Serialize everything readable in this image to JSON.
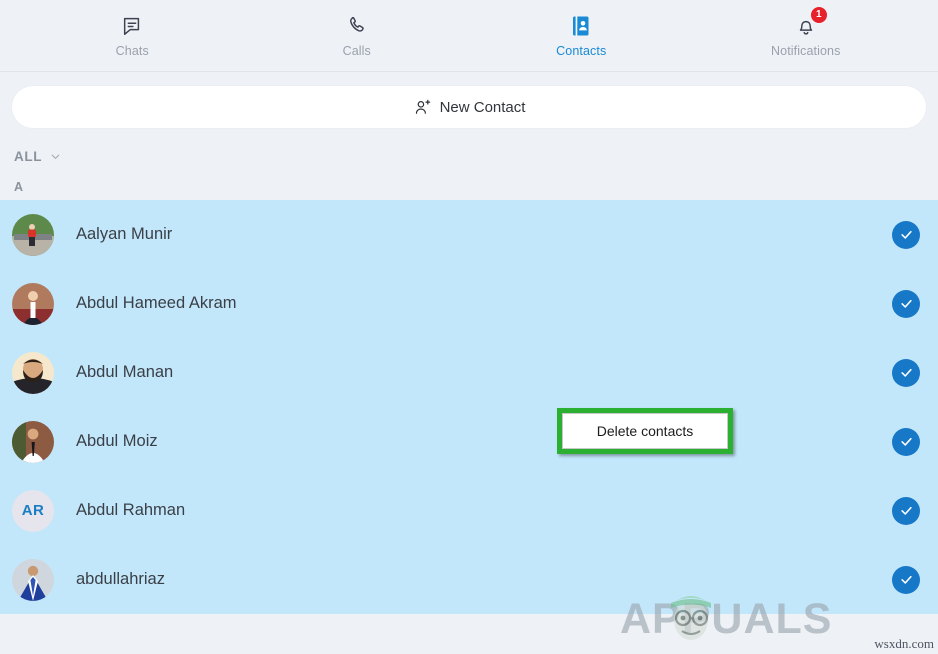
{
  "app": {
    "accent_color": "#1878c8",
    "selection_color": "#c3e7fa",
    "background_color": "#eef1f6",
    "highlight_outline_color": "#2cb032",
    "badge_color": "#e8202a"
  },
  "tabs": [
    {
      "label": "Chats",
      "icon": "chat-bubble-icon",
      "active": false,
      "badge": null
    },
    {
      "label": "Calls",
      "icon": "phone-handset-icon",
      "active": false,
      "badge": null
    },
    {
      "label": "Contacts",
      "icon": "contact-book-icon",
      "active": true,
      "badge": null
    },
    {
      "label": "Notifications",
      "icon": "bell-icon",
      "active": false,
      "badge": "1"
    }
  ],
  "new_contact": {
    "label": "New Contact",
    "icon": "person-plus-icon"
  },
  "filter": {
    "label": "ALL",
    "icon": "chevron-down-icon"
  },
  "list": {
    "section_letter": "A",
    "contacts": [
      {
        "name": "Aalyan Munir",
        "avatar_type": "photo",
        "initials": "",
        "selected": true
      },
      {
        "name": "Abdul Hameed Akram",
        "avatar_type": "photo",
        "initials": "",
        "selected": true
      },
      {
        "name": "Abdul Manan",
        "avatar_type": "photo",
        "initials": "",
        "selected": true
      },
      {
        "name": "Abdul Moiz",
        "avatar_type": "photo",
        "initials": "",
        "selected": true
      },
      {
        "name": "Abdul Rahman",
        "avatar_type": "initials",
        "initials": "AR",
        "selected": true
      },
      {
        "name": "abdullahriaz",
        "avatar_type": "photo",
        "initials": "",
        "selected": true
      }
    ]
  },
  "tooltip": {
    "label": "Delete contacts"
  },
  "watermarks": {
    "brand": "APPUALS",
    "site": "wsxdn.com"
  }
}
